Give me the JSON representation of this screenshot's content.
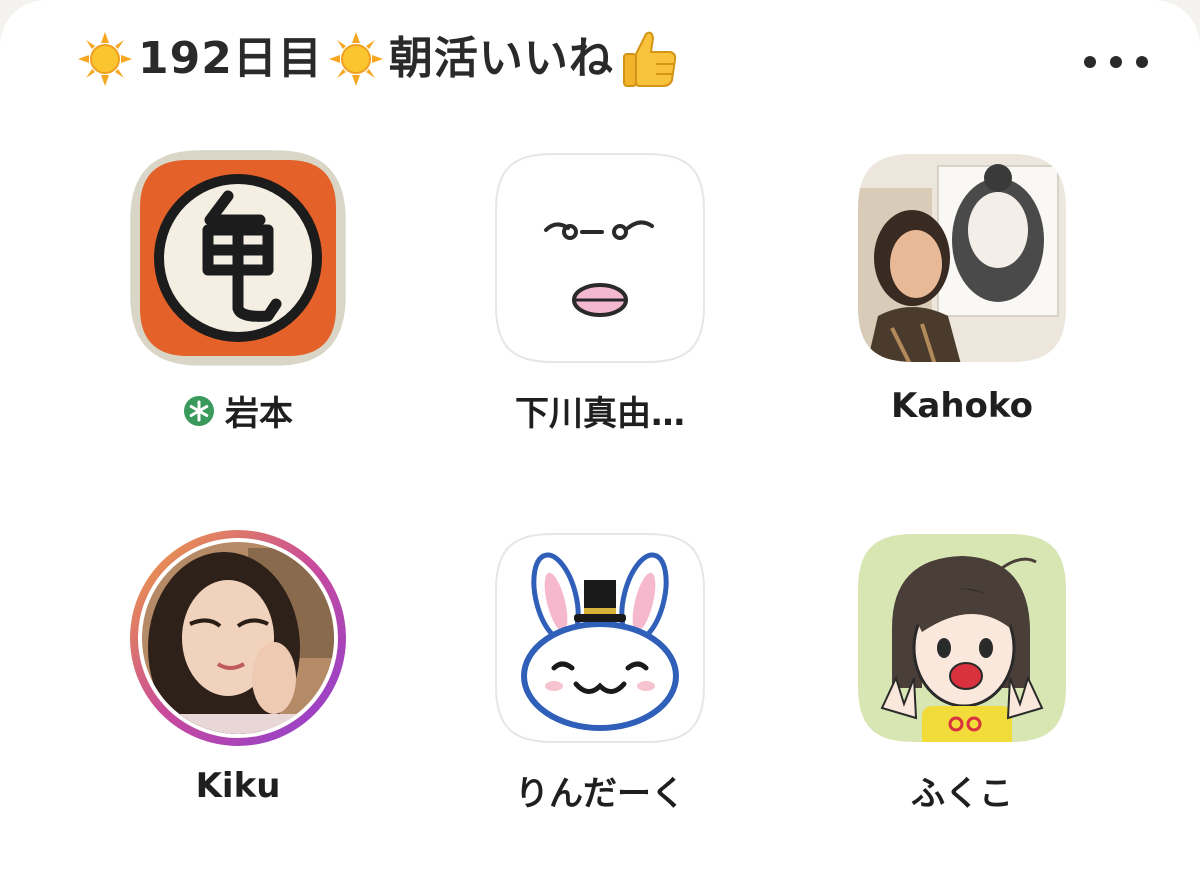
{
  "header": {
    "prefix_icon": "sun-icon",
    "day_text": "192日目",
    "middle_icon": "sun-icon",
    "title_text": "朝活いいね",
    "suffix_icon": "thumbs-up-icon",
    "more_icon": "more-horizontal-icon"
  },
  "members": [
    {
      "name": "岩本",
      "badge_icon": "admin-badge-icon",
      "avatar_icon": "kame-kanji-avatar"
    },
    {
      "name": "下川真由…",
      "avatar_icon": "sleepy-face-avatar"
    },
    {
      "name": "Kahoko",
      "avatar_icon": "photo-avatar"
    },
    {
      "name": "Kiku",
      "avatar_icon": "photo-avatar"
    },
    {
      "name": "りんだーく",
      "avatar_icon": "rabbit-tophat-avatar"
    },
    {
      "name": "ふくこ",
      "avatar_icon": "illustrated-girl-avatar"
    }
  ],
  "colors": {
    "accent_green": "#3a9a5c",
    "kame_orange": "#e4622a",
    "story_ring_start": "#f2a63a",
    "story_ring_end": "#8a3fd6"
  }
}
